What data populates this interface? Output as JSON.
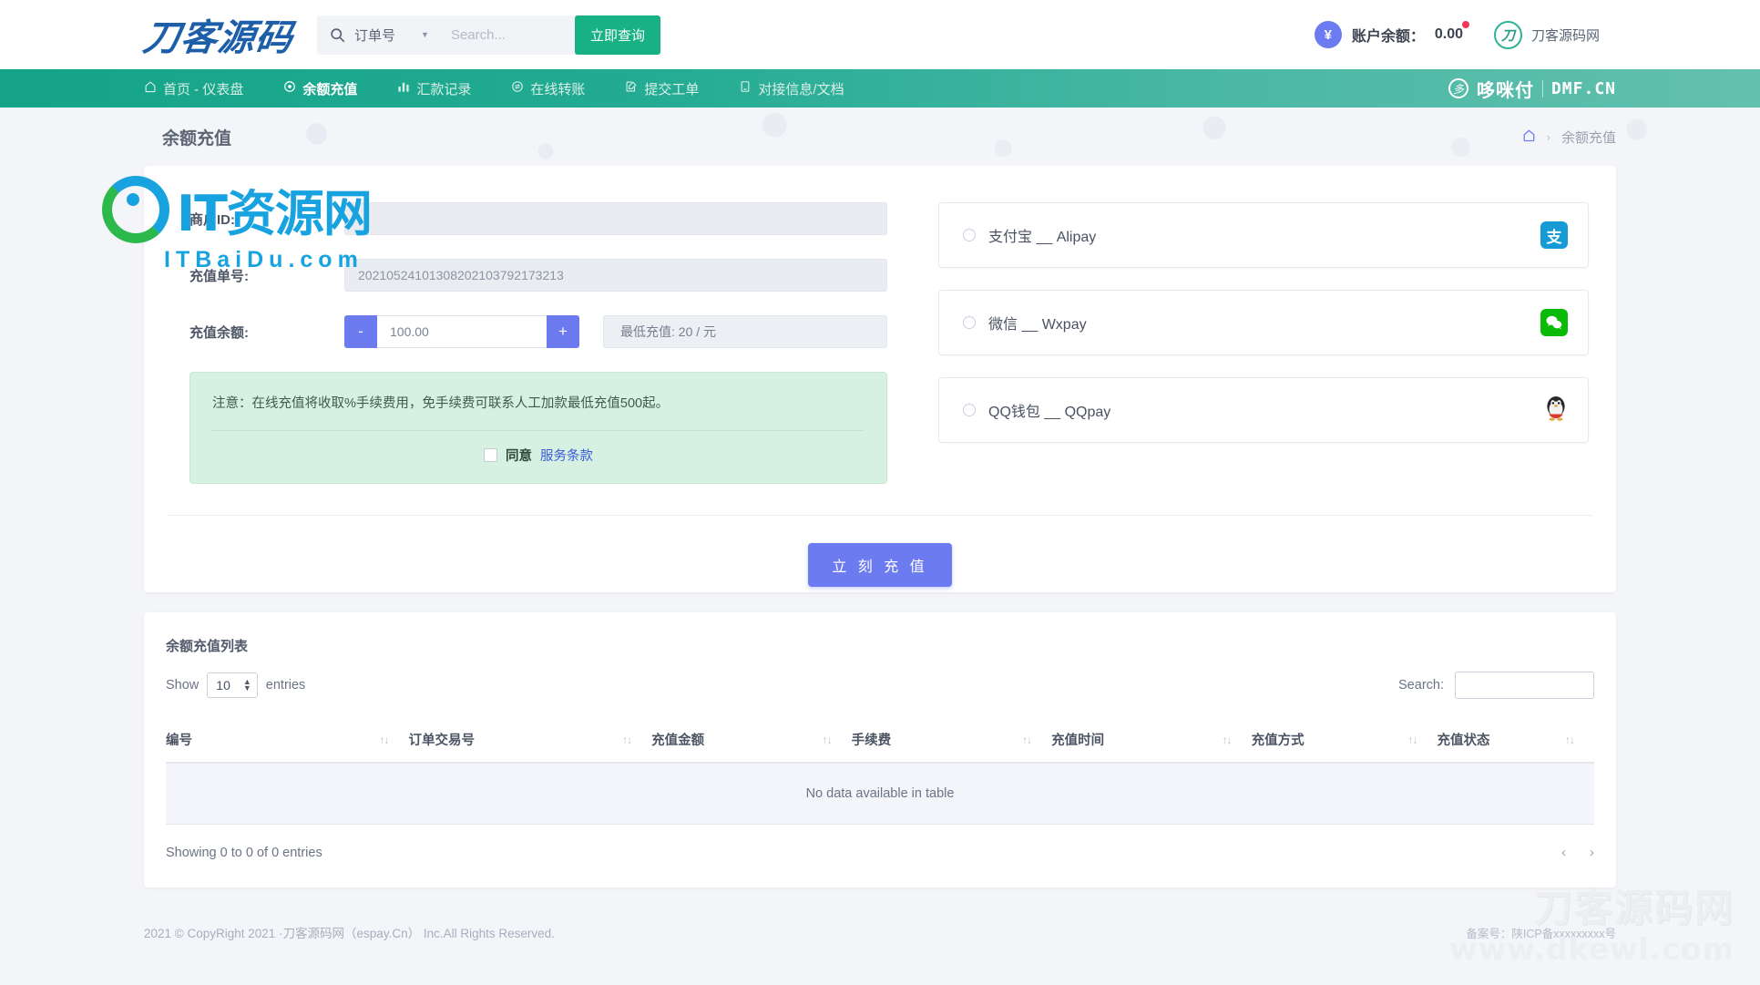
{
  "header": {
    "logo_text": "刀客源码",
    "search": {
      "icon": "search-icon",
      "category": "订单号",
      "caret": "▼",
      "placeholder": "Search...",
      "button_label": "立即查询"
    },
    "balance": {
      "currency_symbol": "¥",
      "label": "账户余额：",
      "value": "0.00"
    },
    "user": {
      "avatar_glyph": "刀",
      "name": "刀客源码网"
    }
  },
  "nav": {
    "items": [
      {
        "label": "首页 - 仪表盘",
        "icon": "home-icon",
        "active": false
      },
      {
        "label": "余额充值",
        "icon": "wallet-icon",
        "active": true
      },
      {
        "label": "汇款记录",
        "icon": "chart-icon",
        "active": false
      },
      {
        "label": "在线转账",
        "icon": "transfer-icon",
        "active": false
      },
      {
        "label": "提交工单",
        "icon": "edit-icon",
        "active": false
      },
      {
        "label": "对接信息/文档",
        "icon": "book-icon",
        "active": false
      }
    ],
    "brand": {
      "circle_glyph": "多",
      "name": "哆咪付",
      "domain": "DMF.CN"
    }
  },
  "page": {
    "title": "余额充值",
    "breadcrumb": {
      "home_icon": "home-icon",
      "separator": "›",
      "current": "余额充值"
    }
  },
  "form": {
    "merchant_id": {
      "label": "商户ID:",
      "value": ""
    },
    "order_no": {
      "label": "充值单号:",
      "value": "20210524101308202103792173213"
    },
    "amount": {
      "label": "充值余额:",
      "minus": "-",
      "plus": "+",
      "value": "100.00",
      "min_note": "最低充值: 20 / 元"
    },
    "notice": {
      "text": "注意：在线充值将收取%手续费用，免手续费可联系人工加款最低充值500起。",
      "agree_label": "同意",
      "terms_link": "服务条款"
    },
    "submit_label": "立 刻 充 值"
  },
  "payments": [
    {
      "label": "支付宝 __ Alipay",
      "icon": "alipay-icon",
      "glyph": "支",
      "selected": false
    },
    {
      "label": "微信 __ Wxpay",
      "icon": "wechat-icon",
      "glyph": "微",
      "selected": false
    },
    {
      "label": "QQ钱包 __ QQpay",
      "icon": "qq-penguin-icon",
      "glyph": "🐧",
      "selected": false
    }
  ],
  "table": {
    "title": "余额充值列表",
    "show_label": "Show",
    "show_value": "10",
    "entries_label": "entries",
    "search_label": "Search:",
    "search_value": "",
    "columns": [
      "编号",
      "订单交易号",
      "充值金额",
      "手续费",
      "充值时间",
      "充值方式",
      "充值状态"
    ],
    "empty_text": "No data available in table",
    "rows": [],
    "showing_text": "Showing 0 to 0 of 0 entries",
    "prev_label": "‹",
    "next_label": "›"
  },
  "footer": {
    "copyright": "2021 © CopyRight 2021 ·刀客源码网（espay.Cn） Inc.All Rights Reserved.",
    "icp": "备案号：陕ICP备xxxxxxxxx号"
  },
  "watermarks": {
    "it": {
      "main": "IT资源网",
      "sub": "ITBaiDu.com"
    },
    "dk": {
      "main": "刀客源码网",
      "sub": "www.dkewl.com"
    }
  },
  "colors": {
    "nav_teal": "#22ab92",
    "accent_blue": "#6c7bf0",
    "query_green": "#17b183",
    "notice_green": "#d6f0e2"
  }
}
